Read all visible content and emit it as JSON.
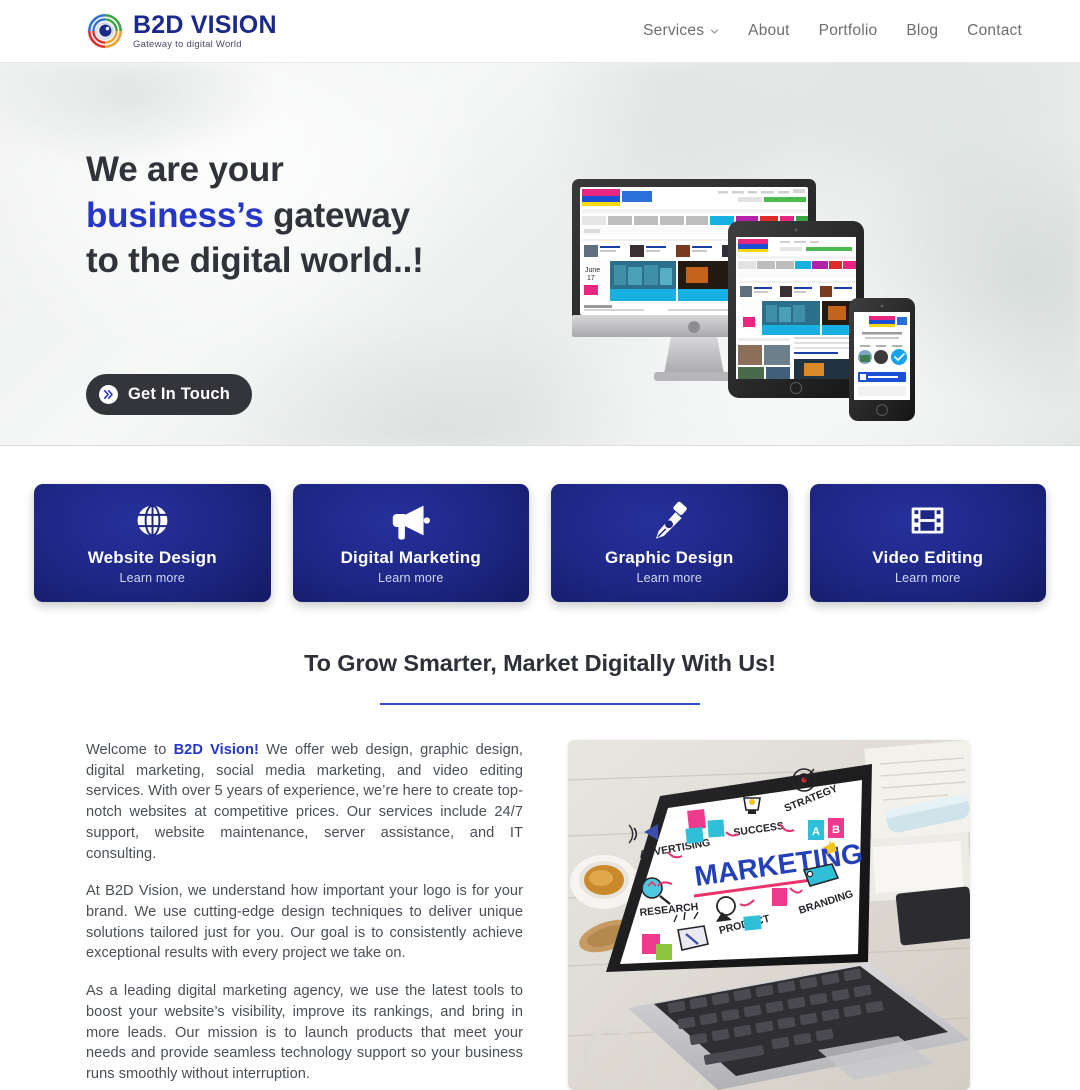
{
  "header": {
    "brand": {
      "title": "B2D VISION",
      "tagline": "Gateway to digital World",
      "logo_icon": "camera-lens-eye-icon",
      "logo_colors": {
        "pupil": "#1b2a8a",
        "green": "#3aa544",
        "orange": "#f2a024",
        "red": "#e02b2b",
        "blue": "#2d6fd6"
      }
    },
    "nav": [
      {
        "label": "Services",
        "has_dropdown": true,
        "icon": "chevron-down-icon"
      },
      {
        "label": "About",
        "has_dropdown": false
      },
      {
        "label": "Portfolio",
        "has_dropdown": false
      },
      {
        "label": "Blog",
        "has_dropdown": false
      },
      {
        "label": "Contact",
        "has_dropdown": false
      }
    ]
  },
  "hero": {
    "line1": "We are your",
    "line2_accent": "business’s",
    "line2_rest": " gateway",
    "line3": "to the digital world..!",
    "cta_label": "Get In Touch",
    "cta_icon": "double-chevron-right-icon",
    "cta_bg": "#34353a",
    "accent_color": "#2536c8",
    "heading_color": "#31333a",
    "mockup": {
      "name": "responsive-device-mockup",
      "devices": [
        "imac-desktop",
        "ipad-tablet",
        "iphone-mobile"
      ]
    }
  },
  "services": [
    {
      "title": "Website Design",
      "subtitle": "Learn more",
      "icon": "globe-icon"
    },
    {
      "title": "Digital Marketing",
      "subtitle": "Learn more",
      "icon": "megaphone-icon"
    },
    {
      "title": "Graphic Design",
      "subtitle": "Learn more",
      "icon": "pen-nib-icon"
    },
    {
      "title": "Video Editing",
      "subtitle": "Learn more",
      "icon": "film-strip-icon"
    }
  ],
  "section": {
    "title": "To Grow Smarter, Market Digitally With Us!",
    "rule_color": "#3a49c9"
  },
  "about": {
    "p1_lead": "Welcome to ",
    "p1_brand": "B2D Vision!",
    "p1_rest": " We offer web design, graphic design, digital marketing, social media marketing, and video editing services. With over 5 years of experience, we’re here to create top-notch websites at competitive prices. Our services include 24/7 support, website maintenance, server assistance, and IT consulting.",
    "p2": "At B2D Vision, we understand how important your logo is for your brand. We use cutting-edge design techniques to deliver unique solutions tailored just for you. Our goal is to consistently achieve exceptional results with every project we take on.",
    "p3": "As a leading digital marketing agency, we use the latest tools to boost your website’s visibility, improve its rankings, and bring in more leads. Our mission is to launch products that meet your needs and provide seamless technology support so your business runs smoothly without interruption.",
    "photo": {
      "name": "marketing-laptop-photo",
      "alt": "Laptop on wooden desk displaying a hand-drawn marketing mind map",
      "screen_center_word": "MARKETING",
      "screen_labels": [
        "ADVERTISING",
        "SUCCESS",
        "STRATEGY",
        "RESEARCH",
        "PRODUCT",
        "BRANDING"
      ]
    }
  }
}
